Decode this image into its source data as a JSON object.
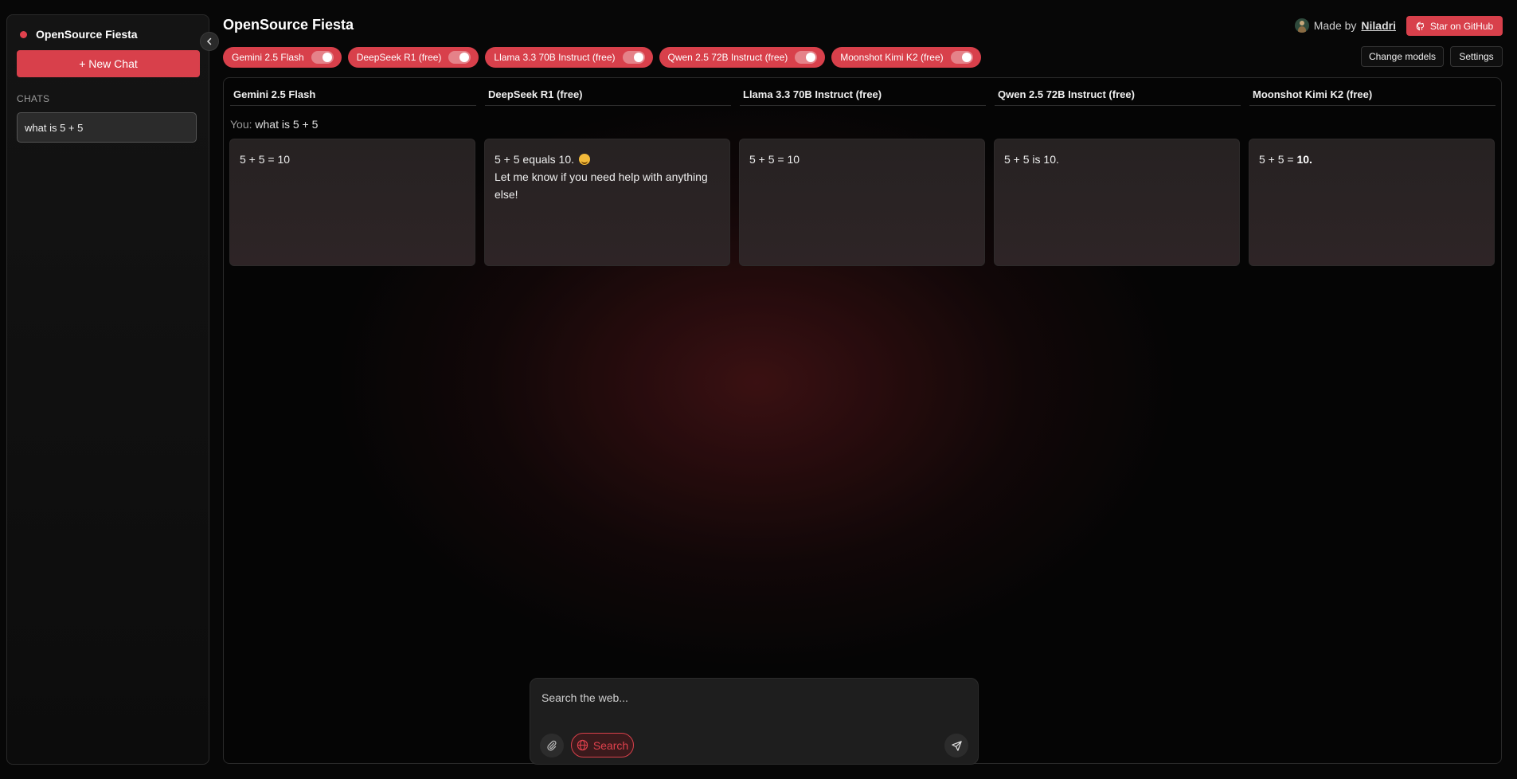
{
  "sidebar": {
    "brand": "OpenSource Fiesta",
    "new_chat": "+ New Chat",
    "chats_label": "CHATS",
    "chats": [
      "what is 5 + 5"
    ]
  },
  "header": {
    "title": "OpenSource Fiesta",
    "made_by": "Made by",
    "author": "Niladri",
    "star_button": "Star on GitHub",
    "change_models": "Change models",
    "settings": "Settings"
  },
  "model_chips": [
    {
      "label": "Gemini 2.5 Flash",
      "enabled": true
    },
    {
      "label": "DeepSeek R1 (free)",
      "enabled": true
    },
    {
      "label": "Llama 3.3 70B Instruct (free)",
      "enabled": true
    },
    {
      "label": "Qwen 2.5 72B Instruct (free)",
      "enabled": true
    },
    {
      "label": "Moonshot Kimi K2 (free)",
      "enabled": true
    }
  ],
  "columns": [
    {
      "title": "Gemini 2.5 Flash",
      "response": [
        "5 + 5 = 10"
      ]
    },
    {
      "title": "DeepSeek R1 (free)",
      "response": [
        "5 + 5 equals 10.",
        "Let me know if you need help with anything",
        "else!"
      ]
    },
    {
      "title": "Llama 3.3 70B Instruct (free)",
      "response": [
        "5 + 5 = 10"
      ]
    },
    {
      "title": "Qwen 2.5 72B Instruct (free)",
      "response": [
        "5 + 5 is 10."
      ]
    },
    {
      "title": "Moonshot Kimi K2 (free)",
      "response_prefix": "5 + 5 = ",
      "response_bold": "10."
    }
  ],
  "user_message": {
    "label": "You:",
    "text": "what is 5 + 5"
  },
  "composer": {
    "placeholder": "Search the web...",
    "search_label": "Search"
  },
  "colors": {
    "accent": "#d8404b",
    "background": "#070707"
  }
}
